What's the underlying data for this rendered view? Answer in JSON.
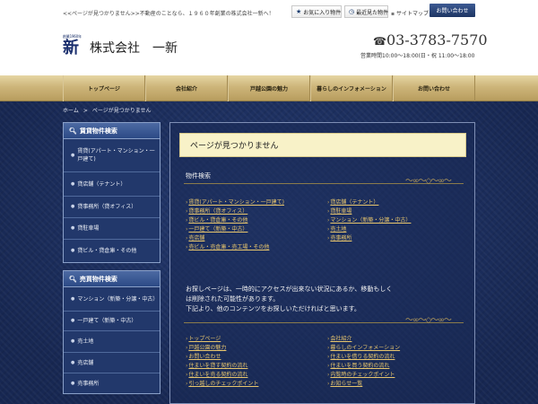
{
  "header": {
    "tagline": "<<ページが見つかりません>>不動産のことなら、１９６０年創業の株式会社一新へ！",
    "favorites_label": "お気に入り物件",
    "recent_label": "最近見た物件",
    "sitemap_label": "サイトマップ",
    "contact_label": "お問い合わせ",
    "logo_small_text": "創業1960年",
    "logo_kanji": "新",
    "company_name": "株式会社　一新",
    "phone": "03-3783-7570",
    "hours": "営業時間10:00～18:00(日・祝 11:00～18:00"
  },
  "nav": {
    "items": [
      {
        "label": "トップページ"
      },
      {
        "label": "会社紹介"
      },
      {
        "label": "戸越公園の魅力"
      },
      {
        "label": "暮らしのインフォメーション"
      },
      {
        "label": "お問い合わせ"
      }
    ]
  },
  "breadcrumb": {
    "home": "ホーム",
    "separator": ">",
    "current": "ページが見つかりません"
  },
  "sidebar": {
    "rental": {
      "title": "賃貸物件検索",
      "items": [
        {
          "label": "賃貸(アパート・マンション・一戸建て)"
        },
        {
          "label": "貸店舗（テナント）"
        },
        {
          "label": "貸事務所（貸オフィス）"
        },
        {
          "label": "貸駐車場"
        },
        {
          "label": "貸ビル・貸倉庫・その他"
        }
      ]
    },
    "sale": {
      "title": "売買物件検索",
      "items": [
        {
          "label": "マンション（新築・分譲・中古）"
        },
        {
          "label": "一戸建て（新築・中古）"
        },
        {
          "label": "売土地"
        },
        {
          "label": "売店舗"
        },
        {
          "label": "売事務所"
        }
      ]
    }
  },
  "content": {
    "not_found_title": "ページが見つかりません",
    "search_title": "物件検索",
    "search_left": [
      {
        "label": "賃貸(アパート・マンション・一戸建て)"
      },
      {
        "label": "貸事務所（貸オフィス）"
      },
      {
        "label": "貸ビル・貸倉庫・その他"
      },
      {
        "label": "一戸建て（新築・中古）"
      },
      {
        "label": "売店舗"
      },
      {
        "label": "売ビル・売倉庫・売工場・その他"
      }
    ],
    "search_right": [
      {
        "label": "貸店舗（テナント）"
      },
      {
        "label": "貸駐車場"
      },
      {
        "label": "マンション（新築・分譲・中古）"
      },
      {
        "label": "売土地"
      },
      {
        "label": "売事務所"
      }
    ],
    "message_lines": [
      "お探しページは、一時的にアクセスが出来ない状況にあるか、移動もしく",
      "は削除された可能性があります。",
      "下記より、他のコンテンツをお探しいただければと思います。"
    ],
    "links_left": [
      {
        "label": "トップページ"
      },
      {
        "label": "戸越公園の魅力"
      },
      {
        "label": "お問い合わせ"
      },
      {
        "label": "住まいを貸す契約の流れ"
      },
      {
        "label": "住まいを売る契約の流れ"
      },
      {
        "label": "引っ越しのチェックポイント"
      }
    ],
    "links_right": [
      {
        "label": "会社紹介"
      },
      {
        "label": "暮らしのインフォメーション"
      },
      {
        "label": "住まいを借りる契約の流れ"
      },
      {
        "label": "住まいを買う契約の流れ"
      },
      {
        "label": "内覧時のチェックポイント"
      },
      {
        "label": "お知らせ一覧"
      }
    ]
  },
  "colors": {
    "navy_bg": "#1c2e5b",
    "gold_nav": "#cdb57a",
    "link_gold": "#e8c66d",
    "notfound_bg": "#f8f2c8"
  },
  "icons": {
    "favorites": "star-icon",
    "recent": "clock-icon",
    "sitemap": "list-icon",
    "phone": "phone-icon",
    "search": "magnifier-icon"
  }
}
